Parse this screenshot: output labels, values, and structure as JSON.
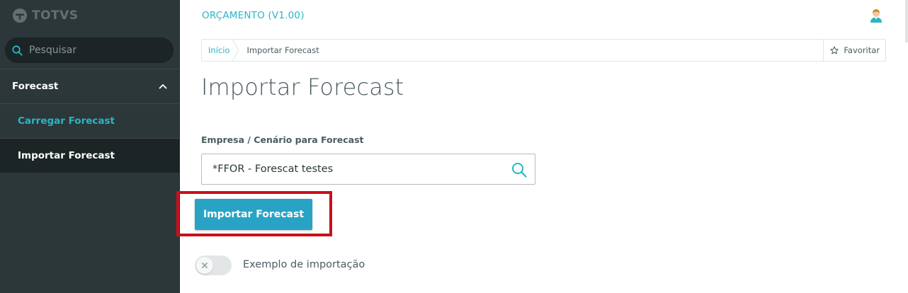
{
  "sidebar": {
    "logo_text": "TOTVS",
    "search": {
      "placeholder": "Pesquisar",
      "value": ""
    },
    "group": {
      "label": "Forecast",
      "expanded": true
    },
    "items": [
      {
        "label": "Carregar Forecast",
        "active": false
      },
      {
        "label": "Importar Forecast",
        "active": true
      }
    ]
  },
  "header": {
    "app_title": "ORÇAMENTO (V1.00)",
    "user_icon": "user-avatar-icon"
  },
  "breadcrumb": {
    "items": [
      "Início",
      "Importar Forecast"
    ],
    "favorite_label": "Favoritar"
  },
  "page": {
    "title": "Importar Forecast",
    "field_label": "Empresa / Cenário para Forecast",
    "field_value": "*FFOR - Forescat testes",
    "primary_button": "Importar Forecast",
    "switch_label": "Exemplo de importação",
    "switch_on": false
  },
  "colors": {
    "sidebar_bg": "#2c3739",
    "accent": "#29b6c5",
    "button": "#29a3c5",
    "highlight": "#c8101a"
  }
}
